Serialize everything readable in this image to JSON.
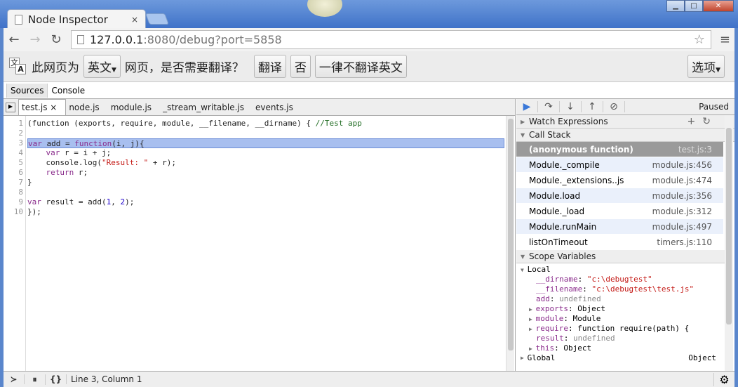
{
  "browser": {
    "tab_title": "Node Inspector",
    "tab_close": "×",
    "url_host": "127.0.0.1",
    "url_rest": ":8080/debug?port=5858"
  },
  "translate": {
    "prefix": "此网页为",
    "language": "英文",
    "question": "网页，是否需要翻译？",
    "translate_btn": "翻译",
    "no_btn": "否",
    "never_btn": "一律不翻译英文",
    "options_btn": "选项"
  },
  "devtools": {
    "tabs": [
      "Sources",
      "Console"
    ],
    "active_tab": "Sources"
  },
  "editor": {
    "file_tabs": [
      "test.js",
      "node.js",
      "module.js",
      "_stream_writable.js",
      "events.js"
    ],
    "active_file": "test.js",
    "current_line": 3,
    "lines": [
      [
        [
          "",
          "(function (exports, require, module, __filename, __dirname) { "
        ],
        [
          "c",
          "//Test app"
        ]
      ],
      [],
      [
        [
          "k",
          "var"
        ],
        [
          "",
          " add = "
        ],
        [
          "k",
          "function"
        ],
        [
          "",
          "(i, j){"
        ]
      ],
      [
        [
          "",
          "    "
        ],
        [
          "k",
          "var"
        ],
        [
          "",
          " r = i + j;"
        ]
      ],
      [
        [
          "",
          "    console.log("
        ],
        [
          "s",
          "\"Result: \""
        ],
        [
          "",
          " + r);"
        ]
      ],
      [
        [
          "",
          "    "
        ],
        [
          "k",
          "return"
        ],
        [
          "",
          " r;"
        ]
      ],
      [
        [
          "",
          "}"
        ]
      ],
      [],
      [
        [
          "k",
          "var"
        ],
        [
          "",
          " result = add("
        ],
        [
          "n",
          "1"
        ],
        [
          "",
          ", "
        ],
        [
          "n",
          "2"
        ],
        [
          "",
          ");"
        ]
      ],
      [
        [
          "",
          "});"
        ]
      ]
    ]
  },
  "debugger": {
    "status": "Paused",
    "watch_label": "Watch Expressions",
    "callstack_label": "Call Stack",
    "callstack": [
      {
        "fn": "(anonymous function)",
        "loc": "test.js:3"
      },
      {
        "fn": "Module._compile",
        "loc": "module.js:456"
      },
      {
        "fn": "Module._extensions..js",
        "loc": "module.js:474"
      },
      {
        "fn": "Module.load",
        "loc": "module.js:356"
      },
      {
        "fn": "Module._load",
        "loc": "module.js:312"
      },
      {
        "fn": "Module.runMain",
        "loc": "module.js:497"
      },
      {
        "fn": "listOnTimeout",
        "loc": "timers.js:110"
      }
    ],
    "scope_label": "Scope Variables",
    "local_label": "Local",
    "locals": [
      {
        "name": "__dirname",
        "value": "\"c:\\debugtest\"",
        "kind": "str",
        "expandable": false
      },
      {
        "name": "__filename",
        "value": "\"c:\\debugtest\\test.js\"",
        "kind": "str",
        "expandable": false
      },
      {
        "name": "add",
        "value": "undefined",
        "kind": "und",
        "expandable": false
      },
      {
        "name": "exports",
        "value": "Object",
        "kind": "obj",
        "expandable": true
      },
      {
        "name": "module",
        "value": "Module",
        "kind": "obj",
        "expandable": true
      },
      {
        "name": "require",
        "value": "function require(path) {",
        "kind": "obj",
        "expandable": true
      },
      {
        "name": "result",
        "value": "undefined",
        "kind": "und",
        "expandable": false
      },
      {
        "name": "this",
        "value": "Object",
        "kind": "obj",
        "expandable": true
      }
    ],
    "global_label": "Global",
    "global_value": "Object"
  },
  "status": {
    "position": "Line 3, Column 1"
  }
}
